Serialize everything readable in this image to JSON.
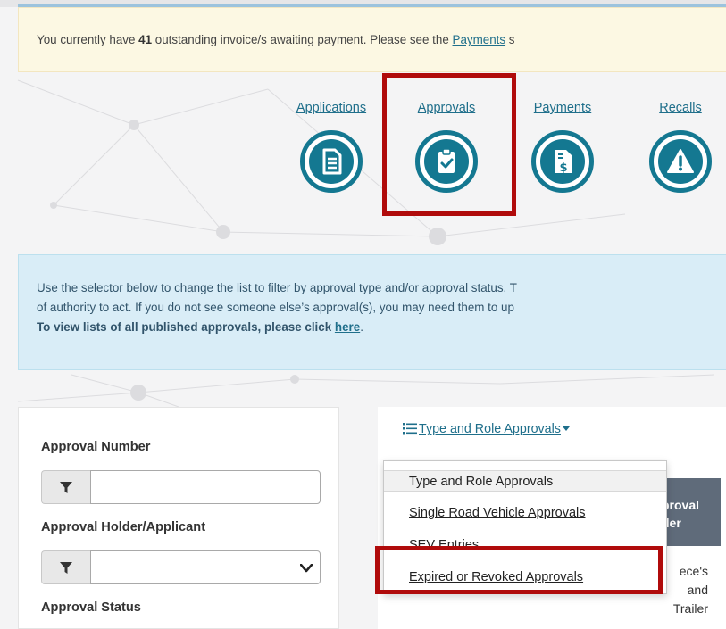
{
  "alert": {
    "prefix": "You currently have ",
    "count": "41",
    "middle": " outstanding invoice/s awaiting payment. Please see the ",
    "link": "Payments",
    "suffix": " s"
  },
  "nav": {
    "items": [
      {
        "label": "Applications",
        "icon": "document-icon"
      },
      {
        "label": "Approvals",
        "icon": "clipboard-check-icon"
      },
      {
        "label": "Payments",
        "icon": "invoice-dollar-icon"
      },
      {
        "label": "Recalls",
        "icon": "warning-triangle-icon"
      }
    ]
  },
  "info": {
    "line1": "Use the selector below to change the list to filter by approval type and/or approval status. T",
    "line2": "of authority to act. If you do not see someone else’s approval(s), you may need them to up",
    "line3_text": "To view lists of all published approvals, please click ",
    "line3_link": "here",
    "line3_end": "."
  },
  "filters": {
    "approval_number_label": "Approval Number",
    "approval_holder_label": "Approval Holder/Applicant",
    "approval_status_label": "Approval Status"
  },
  "results": {
    "dropdown_label": "Type and Role Approvals",
    "table_header_line1": "proval",
    "table_header_line2": "der",
    "cell_line1": "ece's",
    "cell_line2": "and",
    "cell_line3": "Trailer"
  },
  "dropdown_menu": {
    "items": [
      "Type and Role Approvals",
      "Single Road Vehicle Approvals",
      "SEV Entries",
      "Expired or Revoked Approvals"
    ]
  },
  "colors": {
    "accent": "#147891",
    "link": "#1f6f8b",
    "highlight": "#b00b0b",
    "warning_bg": "#fcf8e3",
    "info_bg": "#d9edf7"
  }
}
